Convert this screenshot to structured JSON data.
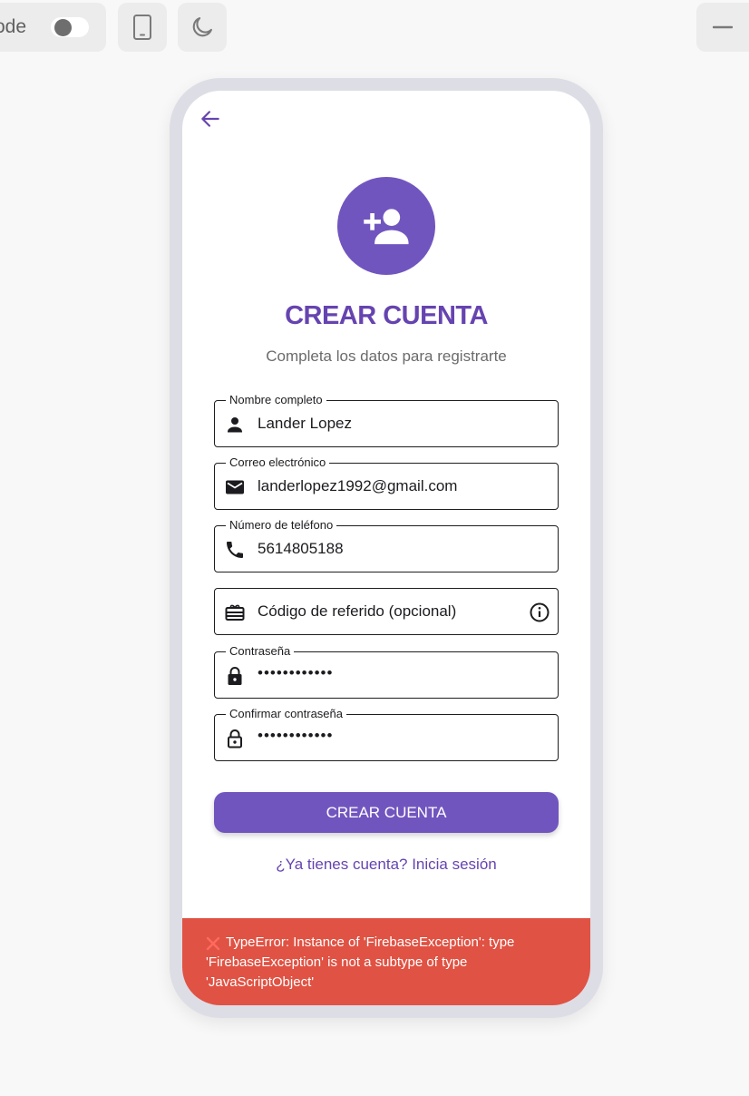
{
  "toolbar": {
    "mode_label": "ode",
    "icons": [
      "phone-icon",
      "moon-icon",
      "minimize-icon"
    ]
  },
  "screen": {
    "back_icon": "arrow-back-icon",
    "avatar_icon": "person-add-icon",
    "title": "CREAR CUENTA",
    "subtitle": "Completa los datos para registrarte",
    "fields": {
      "name": {
        "label": "Nombre completo",
        "value": "Lander Lopez",
        "icon": "person-icon"
      },
      "email": {
        "label": "Correo electrónico",
        "value": "landerlopez1992@gmail.com",
        "icon": "mail-icon"
      },
      "phone": {
        "label": "Número de teléfono",
        "value": "5614805188",
        "icon": "phone-call-icon"
      },
      "referral": {
        "placeholder": "Código de referido (opcional)",
        "icon": "gift-card-icon",
        "suffix_icon": "info-icon"
      },
      "password": {
        "label": "Contraseña",
        "value": "••••••••••••",
        "icon": "lock-icon"
      },
      "confirm_password": {
        "label": "Confirmar contraseña",
        "value": "••••••••••••",
        "icon": "lock-outline-icon"
      }
    },
    "submit_label": "CREAR CUENTA",
    "login_link": "¿Ya tienes cuenta? Inicia sesión"
  },
  "error": {
    "message": "TypeError: Instance of 'FirebaseException': type 'FirebaseException' is not a subtype of type 'JavaScriptObject'",
    "icon": "error-x-icon"
  },
  "colors": {
    "accent": "#7155bf",
    "title": "#6644b0",
    "error_bg": "#e05243",
    "frame": "#dddde6"
  }
}
